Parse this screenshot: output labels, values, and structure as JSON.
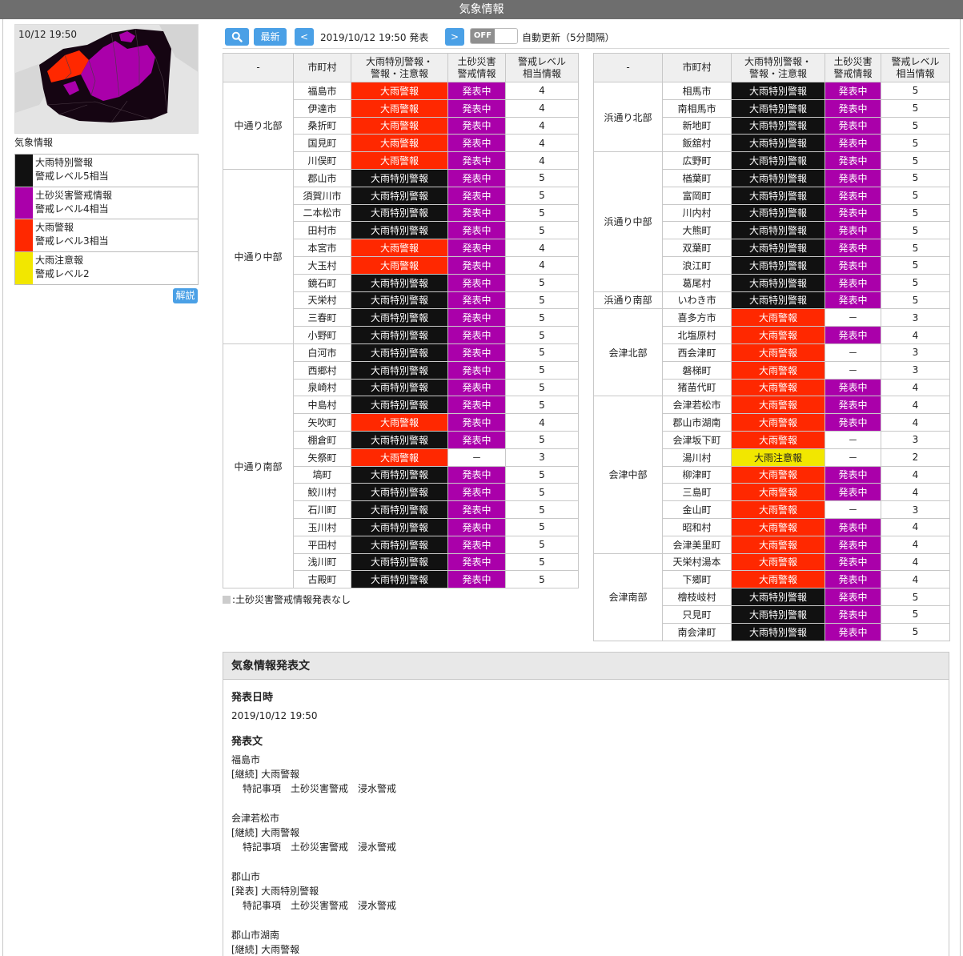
{
  "title": "気象情報",
  "sidebar": {
    "map_time": "10/12 19:50",
    "label": "気象情報",
    "legend": [
      {
        "line1": "大雨特別警報",
        "line2": "警戒レベル5相当",
        "color": "#111111"
      },
      {
        "line1": "土砂災害警戒情報",
        "line2": "警戒レベル4相当",
        "color": "#aa00aa"
      },
      {
        "line1": "大雨警報",
        "line2": "警戒レベル3相当",
        "color": "#ff2800"
      },
      {
        "line1": "大雨注意報",
        "line2": "警戒レベル2",
        "color": "#f2e700"
      }
    ],
    "help_label": "解説"
  },
  "toolbar": {
    "search_icon": "search-icon",
    "latest_label": "最新",
    "prev_label": "<",
    "next_label": ">",
    "date_label": "2019/10/12 19:50 発表",
    "toggle_label": "OFF",
    "auto_label": "自動更新（5分間隔）"
  },
  "table_headers": [
    "-",
    "市町村",
    "大雨特別警報・警報・注意報",
    "土砂災害警戒情報",
    "警戒レベル相当情報"
  ],
  "header_lines": {
    "col2_a": "大雨特別警報・",
    "col2_b": "警報・注意報",
    "col3_a": "土砂災害",
    "col3_b": "警戒情報",
    "col4_a": "警戒レベル",
    "col4_b": "相当情報"
  },
  "colors": {
    "black": "#111111",
    "red": "#ff2800",
    "purple": "#aa00aa",
    "yellow": "#f2e700"
  },
  "left_table": [
    {
      "region": "中通り北部",
      "rows": [
        [
          "福島市",
          "大雨警報",
          "発表中",
          "4"
        ],
        [
          "伊達市",
          "大雨警報",
          "発表中",
          "4"
        ],
        [
          "桑折町",
          "大雨警報",
          "発表中",
          "4"
        ],
        [
          "国見町",
          "大雨警報",
          "発表中",
          "4"
        ],
        [
          "川俣町",
          "大雨警報",
          "発表中",
          "4"
        ]
      ]
    },
    {
      "region": "中通り中部",
      "rows": [
        [
          "郡山市",
          "大雨特別警報",
          "発表中",
          "5"
        ],
        [
          "須賀川市",
          "大雨特別警報",
          "発表中",
          "5"
        ],
        [
          "二本松市",
          "大雨特別警報",
          "発表中",
          "5"
        ],
        [
          "田村市",
          "大雨特別警報",
          "発表中",
          "5"
        ],
        [
          "本宮市",
          "大雨警報",
          "発表中",
          "4"
        ],
        [
          "大玉村",
          "大雨警報",
          "発表中",
          "4"
        ],
        [
          "鏡石町",
          "大雨特別警報",
          "発表中",
          "5"
        ],
        [
          "天栄村",
          "大雨特別警報",
          "発表中",
          "5"
        ],
        [
          "三春町",
          "大雨特別警報",
          "発表中",
          "5"
        ],
        [
          "小野町",
          "大雨特別警報",
          "発表中",
          "5"
        ]
      ]
    },
    {
      "region": "中通り南部",
      "rows": [
        [
          "白河市",
          "大雨特別警報",
          "発表中",
          "5"
        ],
        [
          "西郷村",
          "大雨特別警報",
          "発表中",
          "5"
        ],
        [
          "泉崎村",
          "大雨特別警報",
          "発表中",
          "5"
        ],
        [
          "中島村",
          "大雨特別警報",
          "発表中",
          "5"
        ],
        [
          "矢吹町",
          "大雨警報",
          "発表中",
          "4"
        ],
        [
          "棚倉町",
          "大雨特別警報",
          "発表中",
          "5"
        ],
        [
          "矢祭町",
          "大雨警報",
          "－",
          "3"
        ],
        [
          "塙町",
          "大雨特別警報",
          "発表中",
          "5"
        ],
        [
          "鮫川村",
          "大雨特別警報",
          "発表中",
          "5"
        ],
        [
          "石川町",
          "大雨特別警報",
          "発表中",
          "5"
        ],
        [
          "玉川村",
          "大雨特別警報",
          "発表中",
          "5"
        ],
        [
          "平田村",
          "大雨特別警報",
          "発表中",
          "5"
        ],
        [
          "浅川町",
          "大雨特別警報",
          "発表中",
          "5"
        ],
        [
          "古殿町",
          "大雨特別警報",
          "発表中",
          "5"
        ]
      ]
    }
  ],
  "right_table": [
    {
      "region": "浜通り北部",
      "rows": [
        [
          "相馬市",
          "大雨特別警報",
          "発表中",
          "5"
        ],
        [
          "南相馬市",
          "大雨特別警報",
          "発表中",
          "5"
        ],
        [
          "新地町",
          "大雨特別警報",
          "発表中",
          "5"
        ],
        [
          "飯舘村",
          "大雨特別警報",
          "発表中",
          "5"
        ]
      ]
    },
    {
      "region": "浜通り中部",
      "rows": [
        [
          "広野町",
          "大雨特別警報",
          "発表中",
          "5"
        ],
        [
          "楢葉町",
          "大雨特別警報",
          "発表中",
          "5"
        ],
        [
          "富岡町",
          "大雨特別警報",
          "発表中",
          "5"
        ],
        [
          "川内村",
          "大雨特別警報",
          "発表中",
          "5"
        ],
        [
          "大熊町",
          "大雨特別警報",
          "発表中",
          "5"
        ],
        [
          "双葉町",
          "大雨特別警報",
          "発表中",
          "5"
        ],
        [
          "浪江町",
          "大雨特別警報",
          "発表中",
          "5"
        ],
        [
          "葛尾村",
          "大雨特別警報",
          "発表中",
          "5"
        ]
      ]
    },
    {
      "region": "浜通り南部",
      "rows": [
        [
          "いわき市",
          "大雨特別警報",
          "発表中",
          "5"
        ]
      ]
    },
    {
      "region": "会津北部",
      "rows": [
        [
          "喜多方市",
          "大雨警報",
          "－",
          "3"
        ],
        [
          "北塩原村",
          "大雨警報",
          "発表中",
          "4"
        ],
        [
          "西会津町",
          "大雨警報",
          "－",
          "3"
        ],
        [
          "磐梯町",
          "大雨警報",
          "－",
          "3"
        ],
        [
          "猪苗代町",
          "大雨警報",
          "発表中",
          "4"
        ]
      ]
    },
    {
      "region": "会津中部",
      "rows": [
        [
          "会津若松市",
          "大雨警報",
          "発表中",
          "4"
        ],
        [
          "郡山市湖南",
          "大雨警報",
          "発表中",
          "4"
        ],
        [
          "会津坂下町",
          "大雨警報",
          "－",
          "3"
        ],
        [
          "湯川村",
          "大雨注意報",
          "－",
          "2"
        ],
        [
          "柳津町",
          "大雨警報",
          "発表中",
          "4"
        ],
        [
          "三島町",
          "大雨警報",
          "発表中",
          "4"
        ],
        [
          "金山町",
          "大雨警報",
          "－",
          "3"
        ],
        [
          "昭和村",
          "大雨警報",
          "発表中",
          "4"
        ],
        [
          "会津美里町",
          "大雨警報",
          "発表中",
          "4"
        ]
      ]
    },
    {
      "region": "会津南部",
      "rows": [
        [
          "天栄村湯本",
          "大雨警報",
          "発表中",
          "4"
        ],
        [
          "下郷町",
          "大雨警報",
          "発表中",
          "4"
        ],
        [
          "檜枝岐村",
          "大雨特別警報",
          "発表中",
          "5"
        ],
        [
          "只見町",
          "大雨特別警報",
          "発表中",
          "5"
        ],
        [
          "南会津町",
          "大雨特別警報",
          "発表中",
          "5"
        ]
      ]
    }
  ],
  "note": ":土砂災害警戒情報発表なし",
  "bulletin": {
    "title": "気象情報発表文",
    "date_heading": "発表日時",
    "date_value": "2019/10/12 19:50",
    "text_heading": "発表文",
    "entries": [
      {
        "city": "福島市",
        "status": "[継続] 大雨警報",
        "detail": "特記事項　土砂災害警戒　浸水警戒"
      },
      {
        "city": "会津若松市",
        "status": "[継続] 大雨警報",
        "detail": "特記事項　土砂災害警戒　浸水警戒"
      },
      {
        "city": "郡山市",
        "status": "[発表] 大雨特別警報",
        "detail": "特記事項　土砂災害警戒　浸水警戒"
      },
      {
        "city": "郡山市湖南",
        "status": "[継続] 大雨警報",
        "detail": ""
      }
    ]
  }
}
